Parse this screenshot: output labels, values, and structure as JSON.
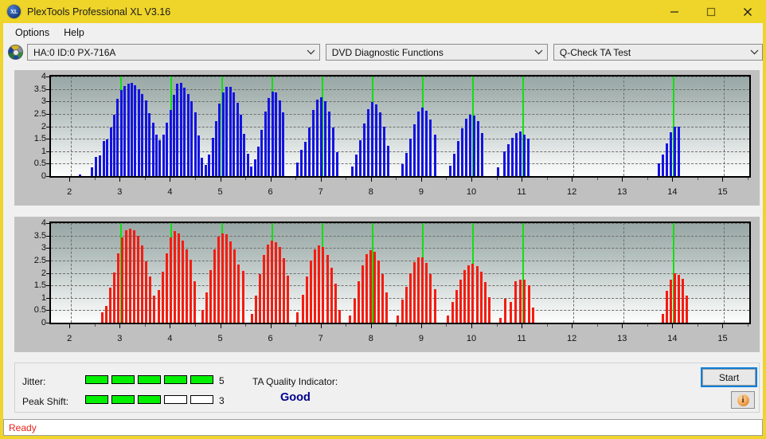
{
  "window": {
    "title": "PlexTools Professional XL V3.16",
    "app_icon": "xl-disc-icon",
    "minimize": "minimize-icon",
    "maximize": "maximize-icon",
    "close": "close-icon",
    "titlebar_color": "#efd42a"
  },
  "menu": {
    "items": [
      {
        "label": "Options"
      },
      {
        "label": "Help"
      }
    ]
  },
  "selectors": {
    "drive_icon": "optical-disc-icon",
    "drive": {
      "value": "HA:0 ID:0  PX-716A"
    },
    "function": {
      "value": "DVD Diagnostic Functions"
    },
    "test": {
      "value": "Q-Check TA Test"
    }
  },
  "charts": {
    "y_ticks": [
      "4",
      "3.5",
      "3",
      "2.5",
      "2",
      "1.5",
      "1",
      "0.5",
      "0"
    ],
    "x_ticks": [
      "2",
      "3",
      "4",
      "5",
      "6",
      "7",
      "8",
      "9",
      "10",
      "11",
      "12",
      "13",
      "14",
      "15"
    ],
    "marker_color": "#11e011",
    "top_color": "#1414e0",
    "bottom_color": "#f41c10"
  },
  "chart_data": [
    {
      "type": "bar",
      "title": "TA Test - Jitter (top plot)",
      "xlabel": "",
      "ylabel": "",
      "series_color": "#1414e0",
      "xlim": [
        1.6,
        15.5
      ],
      "ylim": [
        0,
        4
      ],
      "grid": true,
      "markers": [
        3,
        4,
        5,
        6,
        7,
        8,
        9,
        10,
        11,
        14
      ],
      "x": [
        2.18,
        2.42,
        2.5,
        2.58,
        2.65,
        2.72,
        2.79,
        2.86,
        2.93,
        3.0,
        3.07,
        3.14,
        3.21,
        3.28,
        3.35,
        3.42,
        3.49,
        3.56,
        3.63,
        3.7,
        3.77,
        3.84,
        3.91,
        3.98,
        4.05,
        4.12,
        4.19,
        4.26,
        4.33,
        4.4,
        4.47,
        4.54,
        4.61,
        4.68,
        4.75,
        4.82,
        4.89,
        4.96,
        5.03,
        5.1,
        5.17,
        5.24,
        5.31,
        5.38,
        5.45,
        5.52,
        5.59,
        5.66,
        5.73,
        5.8,
        5.87,
        5.94,
        6.01,
        6.08,
        6.15,
        6.22,
        6.5,
        6.58,
        6.66,
        6.74,
        6.82,
        6.9,
        6.98,
        7.06,
        7.14,
        7.22,
        7.3,
        7.6,
        7.68,
        7.76,
        7.84,
        7.92,
        8.0,
        8.08,
        8.16,
        8.24,
        8.32,
        8.6,
        8.68,
        8.76,
        8.84,
        8.92,
        9.0,
        9.08,
        9.16,
        9.24,
        9.55,
        9.63,
        9.71,
        9.79,
        9.87,
        9.95,
        10.03,
        10.11,
        10.19,
        10.5,
        10.62,
        10.7,
        10.78,
        10.86,
        10.94,
        11.02,
        11.1,
        13.7,
        13.78,
        13.86,
        13.94,
        14.02,
        14.1
      ],
      "values": [
        0.06,
        0.35,
        0.78,
        0.82,
        1.4,
        1.48,
        1.95,
        2.45,
        3.12,
        3.45,
        3.62,
        3.72,
        3.73,
        3.65,
        3.48,
        3.3,
        3.05,
        2.52,
        2.16,
        1.68,
        1.43,
        1.65,
        2.13,
        2.67,
        3.25,
        3.72,
        3.75,
        3.56,
        3.3,
        3.0,
        2.55,
        1.62,
        0.75,
        0.44,
        0.88,
        1.55,
        2.22,
        2.9,
        3.35,
        3.58,
        3.58,
        3.35,
        2.95,
        2.45,
        1.7,
        0.9,
        0.38,
        0.68,
        1.2,
        1.85,
        2.6,
        3.15,
        3.4,
        3.35,
        3.05,
        2.55,
        0.55,
        1.05,
        1.38,
        1.95,
        2.65,
        3.08,
        3.18,
        3.02,
        2.6,
        1.95,
        0.95,
        0.4,
        0.88,
        1.45,
        2.1,
        2.7,
        2.97,
        2.88,
        2.55,
        1.98,
        1.22,
        0.48,
        0.92,
        1.5,
        2.08,
        2.58,
        2.74,
        2.62,
        2.28,
        1.65,
        0.42,
        0.9,
        1.42,
        1.92,
        2.3,
        2.47,
        2.43,
        2.2,
        1.72,
        0.35,
        0.98,
        1.28,
        1.55,
        1.72,
        1.8,
        1.65,
        1.52,
        0.52,
        0.88,
        1.32,
        1.75,
        1.98,
        2.0
      ]
    },
    {
      "type": "bar",
      "title": "TA Test - Peak Shift (bottom plot)",
      "xlabel": "",
      "ylabel": "",
      "series_color": "#f41c10",
      "xlim": [
        1.6,
        15.5
      ],
      "ylim": [
        0,
        4
      ],
      "grid": true,
      "markers": [
        3,
        4,
        5,
        6,
        7,
        8,
        9,
        10,
        11,
        14
      ],
      "x": [
        2.62,
        2.7,
        2.78,
        2.86,
        2.94,
        3.02,
        3.1,
        3.18,
        3.26,
        3.34,
        3.42,
        3.5,
        3.58,
        3.66,
        3.74,
        3.82,
        3.9,
        3.98,
        4.06,
        4.14,
        4.22,
        4.3,
        4.38,
        4.46,
        4.62,
        4.7,
        4.78,
        4.86,
        4.94,
        5.02,
        5.1,
        5.18,
        5.26,
        5.34,
        5.42,
        5.6,
        5.68,
        5.76,
        5.84,
        5.92,
        6.0,
        6.08,
        6.16,
        6.24,
        6.32,
        6.5,
        6.62,
        6.7,
        6.78,
        6.86,
        6.94,
        7.02,
        7.1,
        7.18,
        7.26,
        7.34,
        7.55,
        7.64,
        7.72,
        7.8,
        7.88,
        7.96,
        8.04,
        8.12,
        8.2,
        8.28,
        8.5,
        8.6,
        8.68,
        8.76,
        8.84,
        8.92,
        9.0,
        9.08,
        9.16,
        9.24,
        9.5,
        9.6,
        9.68,
        9.76,
        9.84,
        9.92,
        10.0,
        10.08,
        10.16,
        10.24,
        10.32,
        10.55,
        10.65,
        10.75,
        10.85,
        10.95,
        11.03,
        11.11,
        11.19,
        13.78,
        13.86,
        13.94,
        14.02,
        14.1,
        14.18,
        14.26
      ],
      "values": [
        0.42,
        0.68,
        1.4,
        2.02,
        2.78,
        3.42,
        3.72,
        3.78,
        3.7,
        3.48,
        3.12,
        2.48,
        1.85,
        1.1,
        1.32,
        2.05,
        2.78,
        3.42,
        3.68,
        3.58,
        3.3,
        2.95,
        2.52,
        1.65,
        0.52,
        1.22,
        2.1,
        2.95,
        3.45,
        3.58,
        3.55,
        3.28,
        2.95,
        2.35,
        2.08,
        0.35,
        1.08,
        1.95,
        2.72,
        3.15,
        3.3,
        3.24,
        3.05,
        2.58,
        1.9,
        0.42,
        1.12,
        1.85,
        2.5,
        2.95,
        3.12,
        3.05,
        2.72,
        2.22,
        1.58,
        0.52,
        0.3,
        0.95,
        1.65,
        2.3,
        2.75,
        2.92,
        2.85,
        2.5,
        1.95,
        1.22,
        0.28,
        0.92,
        1.45,
        2.0,
        2.42,
        2.64,
        2.62,
        2.4,
        1.95,
        1.35,
        0.28,
        0.82,
        1.3,
        1.72,
        2.1,
        2.32,
        2.38,
        2.28,
        2.05,
        1.62,
        1.02,
        0.18,
        0.95,
        0.82,
        1.68,
        1.74,
        1.72,
        1.52,
        0.62,
        0.35,
        1.28,
        1.72,
        1.98,
        1.92,
        1.75,
        1.08
      ]
    }
  ],
  "indicators": {
    "jitter": {
      "label": "Jitter:",
      "filled": 5,
      "total": 5,
      "value": "5"
    },
    "peak_shift": {
      "label": "Peak Shift:",
      "filled": 3,
      "total": 5,
      "value": "3"
    },
    "ta_quality": {
      "label": "TA Quality Indicator:",
      "value": "Good",
      "color": "#00008f"
    }
  },
  "actions": {
    "start": "Start",
    "info_icon": "info-icon"
  },
  "status": {
    "text": "Ready",
    "color": "#e8211a"
  }
}
